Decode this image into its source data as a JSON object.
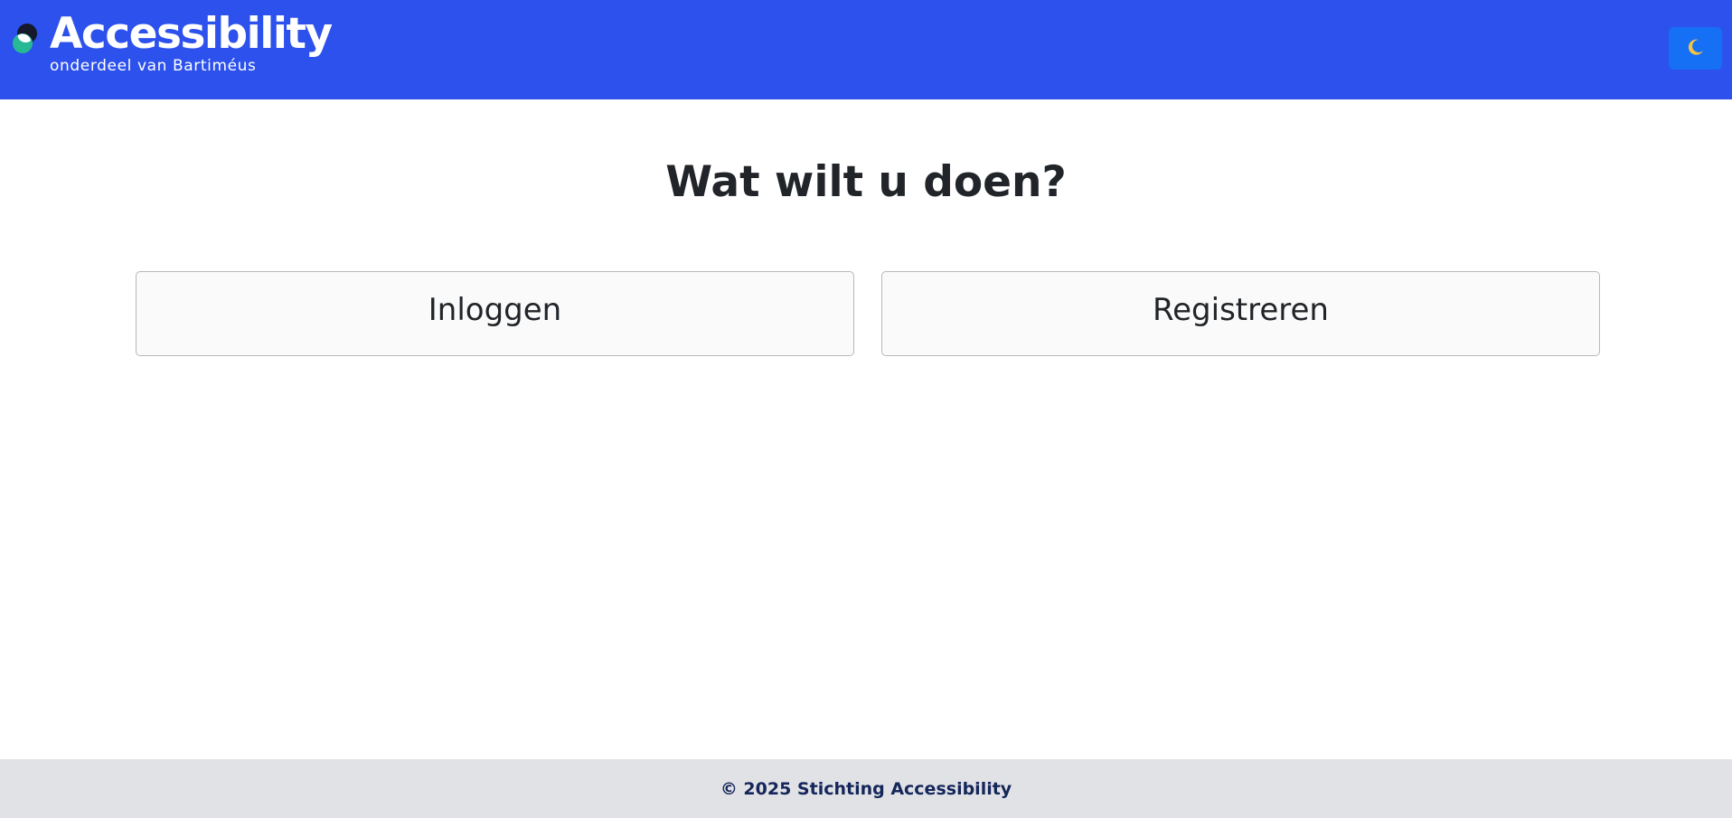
{
  "header": {
    "logo": {
      "title": "Accessibility",
      "subtitle": "onderdeel van Bartiméus",
      "mark_colors": {
        "dark": "#15192b",
        "white": "#ffffff",
        "green": "#27b895"
      }
    },
    "background_color": "#2d51ec",
    "theme_toggle": {
      "icon": "moon-icon",
      "icon_color": "#f6c343",
      "background_color": "#1670f6"
    }
  },
  "main": {
    "heading": "Wat wilt u doen?",
    "actions": {
      "login_label": "Inloggen",
      "register_label": "Registreren"
    }
  },
  "footer": {
    "text": "© 2025 Stichting Accessibility",
    "background_color": "#e1e2e5",
    "text_color": "#14265a"
  }
}
